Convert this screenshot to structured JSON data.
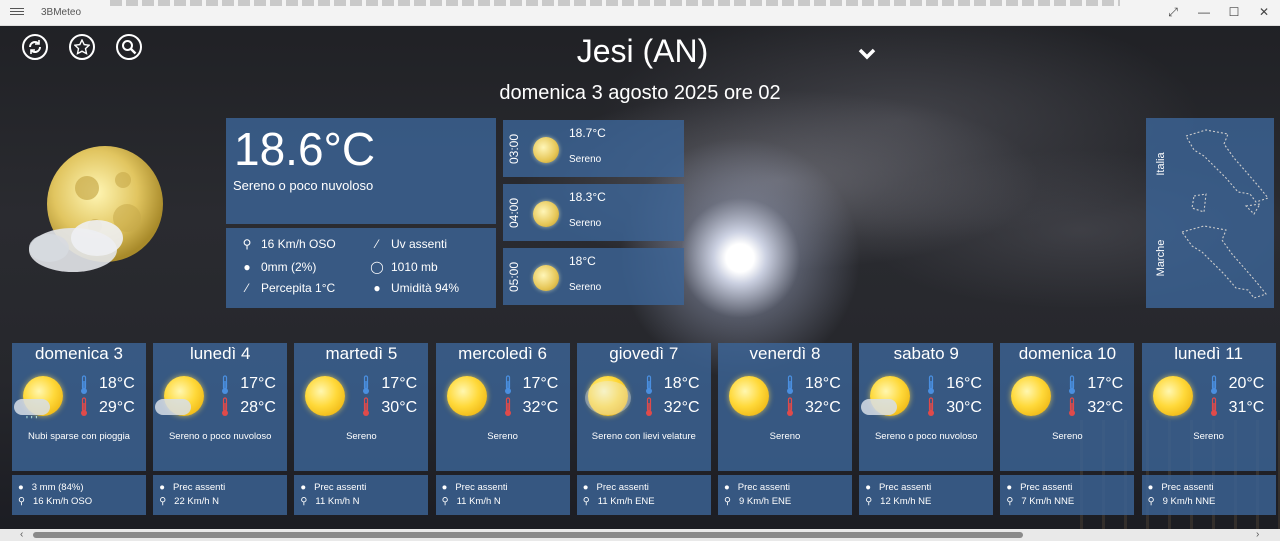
{
  "window": {
    "app_title": "3BMeteo"
  },
  "header": {
    "city": "Jesi (AN)",
    "date": "domenica 3 agosto 2025 ore 02"
  },
  "toolbar": {
    "icons": [
      "refresh-icon",
      "star-icon",
      "search-icon"
    ]
  },
  "current": {
    "temperature": "18.6°C",
    "description": "Sereno o poco nuvoloso",
    "wind": "16 Km/h OSO",
    "precip": "0mm (2%)",
    "perceived": "Percepita 1°C",
    "uv": "Uv assenti",
    "pressure": "1010 mb",
    "humidity": "Umidità 94%"
  },
  "hourly": [
    {
      "hour": "03:00",
      "temp": "18.7°C",
      "desc": "Sereno"
    },
    {
      "hour": "04:00",
      "temp": "18.3°C",
      "desc": "Sereno"
    },
    {
      "hour": "05:00",
      "temp": "18°C",
      "desc": "Sereno"
    }
  ],
  "maps": {
    "italia": "Italia",
    "marche": "Marche"
  },
  "days": [
    {
      "name": "domenica 3",
      "tmin": "18°C",
      "tmax": "29°C",
      "desc": "Nubi sparse con pioggia",
      "precip": "3 mm (84%)",
      "wind": "16 Km/h OSO",
      "icon": "sun-cloud-rain"
    },
    {
      "name": "lunedì 4",
      "tmin": "17°C",
      "tmax": "28°C",
      "desc": "Sereno o poco nuvoloso",
      "precip": "Prec assenti",
      "wind": "22 Km/h N",
      "icon": "sun-cloud"
    },
    {
      "name": "martedì 5",
      "tmin": "17°C",
      "tmax": "30°C",
      "desc": "Sereno",
      "precip": "Prec assenti",
      "wind": "11 Km/h N",
      "icon": "sun"
    },
    {
      "name": "mercoledì 6",
      "tmin": "17°C",
      "tmax": "32°C",
      "desc": "Sereno",
      "precip": "Prec assenti",
      "wind": "11 Km/h N",
      "icon": "sun"
    },
    {
      "name": "giovedì 7",
      "tmin": "18°C",
      "tmax": "32°C",
      "desc": "Sereno con lievi velature",
      "precip": "Prec assenti",
      "wind": "11 Km/h ENE",
      "icon": "sun-haze"
    },
    {
      "name": "venerdì 8",
      "tmin": "18°C",
      "tmax": "32°C",
      "desc": "Sereno",
      "precip": "Prec assenti",
      "wind": "9 Km/h ENE",
      "icon": "sun"
    },
    {
      "name": "sabato 9",
      "tmin": "16°C",
      "tmax": "30°C",
      "desc": "Sereno o poco nuvoloso",
      "precip": "Prec assenti",
      "wind": "12 Km/h NE",
      "icon": "sun-cloud"
    },
    {
      "name": "domenica 10",
      "tmin": "17°C",
      "tmax": "32°C",
      "desc": "Sereno",
      "precip": "Prec assenti",
      "wind": "7 Km/h NNE",
      "icon": "sun"
    },
    {
      "name": "lunedì 11",
      "tmin": "20°C",
      "tmax": "31°C",
      "desc": "Sereno",
      "precip": "Prec assenti",
      "wind": "9 Km/h NNE",
      "icon": "sun"
    }
  ],
  "colors": {
    "panel": "#3c6496",
    "thermo_min": "#4a8fe0",
    "thermo_max": "#e04a4a"
  }
}
